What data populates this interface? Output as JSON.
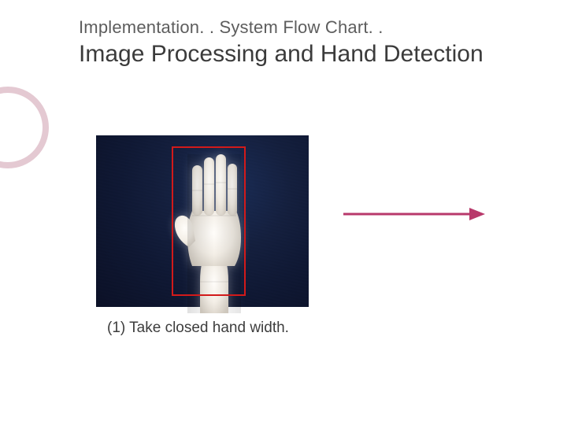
{
  "breadcrumb": "Implementation. . System Flow Chart. .",
  "title": "Image Processing and Hand Detection",
  "caption": "(1) Take closed hand width.",
  "accent": "#b8396b",
  "bbox_color": "#d21a1a"
}
